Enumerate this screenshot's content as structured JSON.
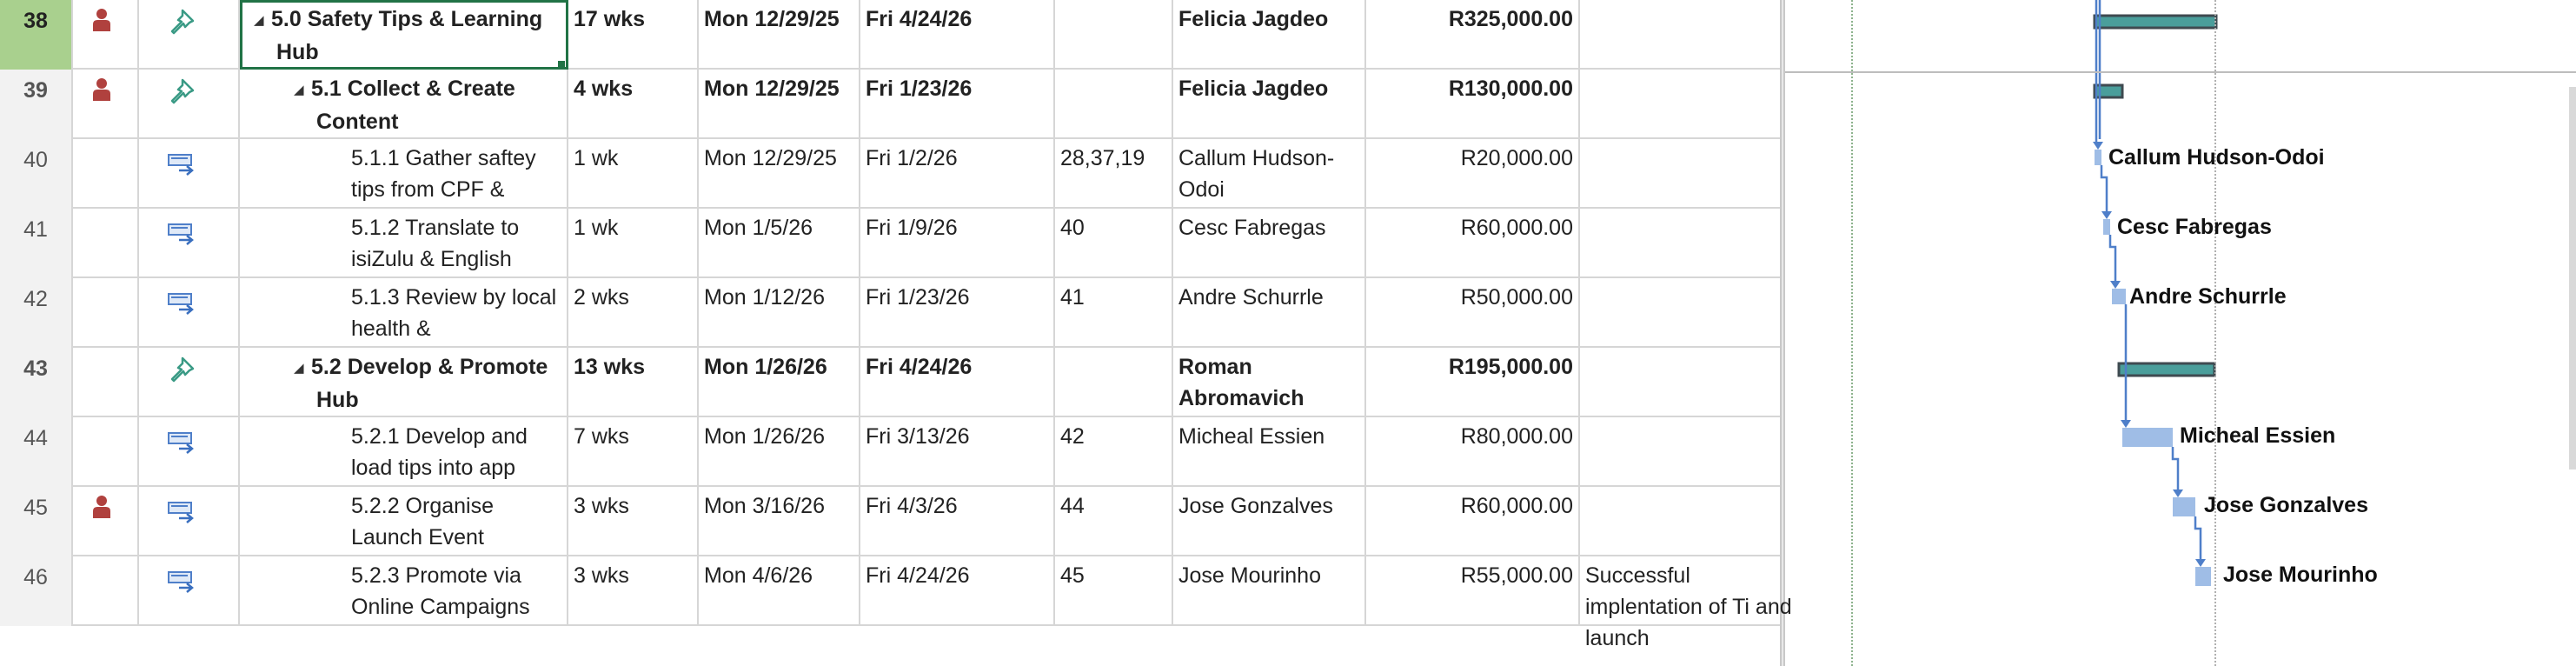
{
  "rows": [
    {
      "id": "38",
      "level": 1,
      "bold": true,
      "summary": true,
      "selected": true,
      "has_user_icon": true,
      "mode": "pin",
      "name": "5.0 Safety Tips & Learning Hub",
      "duration": "17 wks",
      "start": "Mon 12/29/25",
      "finish": "Fri 4/24/26",
      "predecessors": "",
      "resource": "Felicia Jagdeo",
      "cost": "R325,000.00",
      "notes": ""
    },
    {
      "id": "39",
      "level": 2,
      "bold": true,
      "summary": true,
      "selected": false,
      "has_user_icon": true,
      "mode": "pin",
      "name": "5.1 Collect & Create Content",
      "duration": "4 wks",
      "start": "Mon 12/29/25",
      "finish": "Fri 1/23/26",
      "predecessors": "",
      "resource": "Felicia Jagdeo",
      "cost": "R130,000.00",
      "notes": ""
    },
    {
      "id": "40",
      "level": 3,
      "bold": false,
      "summary": false,
      "selected": false,
      "has_user_icon": false,
      "mode": "auto",
      "name": "5.1.1 Gather saftey tips from CPF &",
      "duration": "1 wk",
      "start": "Mon 12/29/25",
      "finish": "Fri 1/2/26",
      "predecessors": "28,37,19",
      "resource": "Callum Hudson-Odoi",
      "cost": "R20,000.00",
      "notes": ""
    },
    {
      "id": "41",
      "level": 3,
      "bold": false,
      "summary": false,
      "selected": false,
      "has_user_icon": false,
      "mode": "auto",
      "name": "5.1.2 Translate to isiZulu & English",
      "duration": "1 wk",
      "start": "Mon 1/5/26",
      "finish": "Fri 1/9/26",
      "predecessors": "40",
      "resource": "Cesc Fabregas",
      "cost": "R60,000.00",
      "notes": ""
    },
    {
      "id": "42",
      "level": 3,
      "bold": false,
      "summary": false,
      "selected": false,
      "has_user_icon": false,
      "mode": "auto",
      "name": "5.1.3 Review by local health &",
      "duration": "2 wks",
      "start": "Mon 1/12/26",
      "finish": "Fri 1/23/26",
      "predecessors": "41",
      "resource": "Andre Schurrle",
      "cost": "R50,000.00",
      "notes": ""
    },
    {
      "id": "43",
      "level": 2,
      "bold": true,
      "summary": true,
      "selected": false,
      "has_user_icon": false,
      "mode": "pin",
      "name": "5.2 Develop & Promote Hub",
      "duration": "13 wks",
      "start": "Mon 1/26/26",
      "finish": "Fri 4/24/26",
      "predecessors": "",
      "resource": "Roman Abromavich",
      "cost": "R195,000.00",
      "notes": ""
    },
    {
      "id": "44",
      "level": 3,
      "bold": false,
      "summary": false,
      "selected": false,
      "has_user_icon": false,
      "mode": "auto",
      "name": "5.2.1 Develop and load tips into app",
      "duration": "7 wks",
      "start": "Mon 1/26/26",
      "finish": "Fri 3/13/26",
      "predecessors": "42",
      "resource": "Micheal Essien",
      "cost": "R80,000.00",
      "notes": ""
    },
    {
      "id": "45",
      "level": 3,
      "bold": false,
      "summary": false,
      "selected": false,
      "has_user_icon": true,
      "mode": "auto",
      "name": "5.2.2 Organise Launch Event",
      "duration": "3 wks",
      "start": "Mon 3/16/26",
      "finish": "Fri 4/3/26",
      "predecessors": "44",
      "resource": "Jose Gonzalves",
      "cost": "R60,000.00",
      "notes": ""
    },
    {
      "id": "46",
      "level": 3,
      "bold": false,
      "summary": false,
      "selected": false,
      "has_user_icon": false,
      "mode": "auto",
      "name": "5.2.3 Promote via Online Campaigns",
      "duration": "3 wks",
      "start": "Mon 4/6/26",
      "finish": "Fri 4/24/26",
      "predecessors": "45",
      "resource": "Jose Mourinho",
      "cost": "R55,000.00",
      "notes": "Successful implentation of Ti and launch"
    }
  ],
  "gantt_labels": [
    "Callum Hudson-Odoi",
    "Cesc Fabregas",
    "Andre Schurrle",
    "Micheal Essien",
    "Jose Gonzalves",
    "Jose Mourinho"
  ],
  "colors": {
    "task_bar": "#9fbde6",
    "summary_bar": "#4a9e9b",
    "summary_outline": "#3f4a50",
    "link": "#4f7fc9",
    "selected_id_bg": "#a9d08e",
    "user_icon": "#b0413e",
    "pin_icon": "#3a9a85"
  },
  "icons": {
    "user": "person-resource-icon",
    "pin": "manually-scheduled-pin-icon",
    "auto": "auto-scheduled-task-icon"
  }
}
